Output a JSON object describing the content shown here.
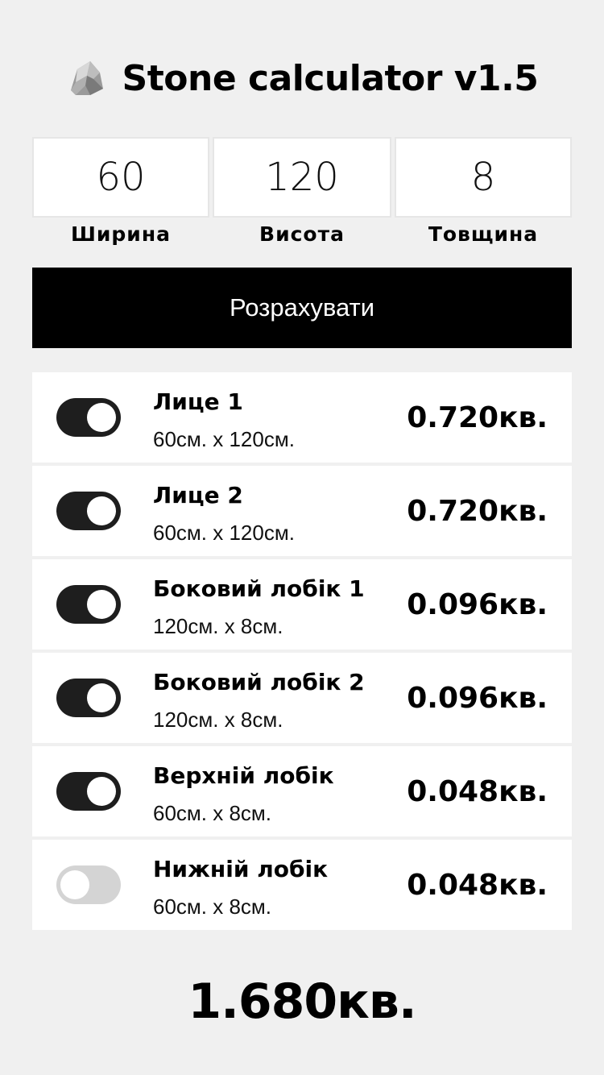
{
  "app": {
    "title": "Stone calculator v1.5",
    "logo_icon": "stone-icon"
  },
  "inputs": [
    {
      "value": "60",
      "label": "Ширина"
    },
    {
      "value": "120",
      "label": "Висота"
    },
    {
      "value": "8",
      "label": "Товщина"
    }
  ],
  "calculate_button": {
    "label": "Розрахувати"
  },
  "pieces": [
    {
      "name": "Лице 1",
      "dims": "60см. х 120см.",
      "area": "0.720кв.",
      "enabled": true
    },
    {
      "name": "Лице 2",
      "dims": "60см. х 120см.",
      "area": "0.720кв.",
      "enabled": true
    },
    {
      "name": "Боковий лобік 1",
      "dims": "120см. х 8см.",
      "area": "0.096кв.",
      "enabled": true
    },
    {
      "name": "Боковий лобік 2",
      "dims": "120см. х 8см.",
      "area": "0.096кв.",
      "enabled": true
    },
    {
      "name": "Верхній лобік",
      "dims": "60см. х 8см.",
      "area": "0.048кв.",
      "enabled": true
    },
    {
      "name": "Нижній лобік",
      "dims": "60см. х 8см.",
      "area": "0.048кв.",
      "enabled": false
    }
  ],
  "total": "1.680кв.",
  "colors": {
    "background": "#f0f0f0",
    "toggle_on": "#1e1e1e",
    "toggle_off": "#d4d4d4",
    "button": "#000000"
  }
}
